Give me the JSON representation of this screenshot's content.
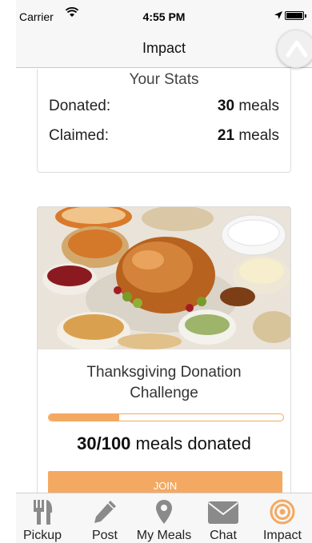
{
  "status_bar": {
    "carrier": "Carrier",
    "time": "4:55 PM"
  },
  "nav": {
    "title": "Impact"
  },
  "stats": {
    "title": "Your Stats",
    "donated": {
      "label": "Donated:",
      "value": "30",
      "unit": "meals"
    },
    "claimed": {
      "label": "Claimed:",
      "value": "21",
      "unit": "meals"
    }
  },
  "challenge": {
    "title": "Thanksgiving Donation Challenge",
    "progress_value": "30/100",
    "progress_suffix": "meals donated",
    "progress_fraction": 0.3,
    "join_label": "JOIN"
  },
  "tabs": [
    {
      "label": "Pickup",
      "icon": "fork-knife-icon"
    },
    {
      "label": "Post",
      "icon": "pencil-icon"
    },
    {
      "label": "My Meals",
      "icon": "map-pin-icon"
    },
    {
      "label": "Chat",
      "icon": "envelope-icon"
    },
    {
      "label": "Impact",
      "icon": "target-icon"
    }
  ],
  "colors": {
    "accent": "#f4a962",
    "tab_gray": "#8a8a8a",
    "active": "#f4a962"
  }
}
